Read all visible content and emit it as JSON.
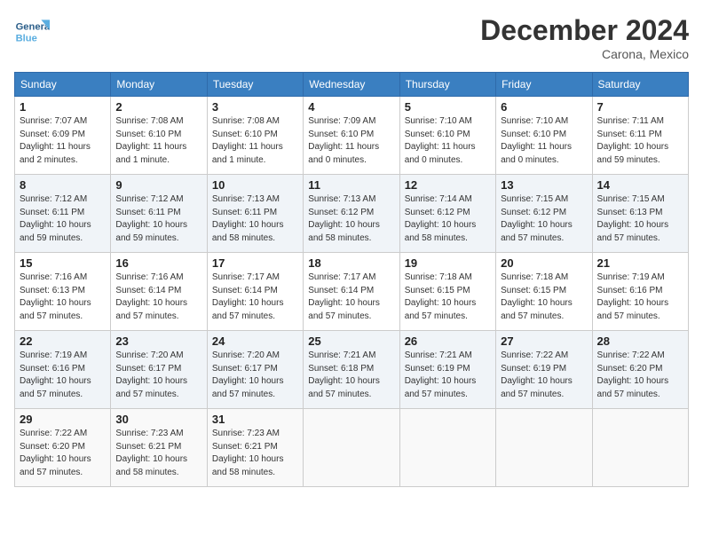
{
  "header": {
    "logo_text_general": "General",
    "logo_text_blue": "Blue",
    "month": "December 2024",
    "location": "Carona, Mexico"
  },
  "days_of_week": [
    "Sunday",
    "Monday",
    "Tuesday",
    "Wednesday",
    "Thursday",
    "Friday",
    "Saturday"
  ],
  "weeks": [
    [
      {
        "day": "1",
        "sunrise": "7:07 AM",
        "sunset": "6:09 PM",
        "daylight": "11 hours and 2 minutes."
      },
      {
        "day": "2",
        "sunrise": "7:08 AM",
        "sunset": "6:10 PM",
        "daylight": "11 hours and 1 minute."
      },
      {
        "day": "3",
        "sunrise": "7:08 AM",
        "sunset": "6:10 PM",
        "daylight": "11 hours and 1 minute."
      },
      {
        "day": "4",
        "sunrise": "7:09 AM",
        "sunset": "6:10 PM",
        "daylight": "11 hours and 0 minutes."
      },
      {
        "day": "5",
        "sunrise": "7:10 AM",
        "sunset": "6:10 PM",
        "daylight": "11 hours and 0 minutes."
      },
      {
        "day": "6",
        "sunrise": "7:10 AM",
        "sunset": "6:10 PM",
        "daylight": "11 hours and 0 minutes."
      },
      {
        "day": "7",
        "sunrise": "7:11 AM",
        "sunset": "6:11 PM",
        "daylight": "10 hours and 59 minutes."
      }
    ],
    [
      {
        "day": "8",
        "sunrise": "7:12 AM",
        "sunset": "6:11 PM",
        "daylight": "10 hours and 59 minutes."
      },
      {
        "day": "9",
        "sunrise": "7:12 AM",
        "sunset": "6:11 PM",
        "daylight": "10 hours and 59 minutes."
      },
      {
        "day": "10",
        "sunrise": "7:13 AM",
        "sunset": "6:11 PM",
        "daylight": "10 hours and 58 minutes."
      },
      {
        "day": "11",
        "sunrise": "7:13 AM",
        "sunset": "6:12 PM",
        "daylight": "10 hours and 58 minutes."
      },
      {
        "day": "12",
        "sunrise": "7:14 AM",
        "sunset": "6:12 PM",
        "daylight": "10 hours and 58 minutes."
      },
      {
        "day": "13",
        "sunrise": "7:15 AM",
        "sunset": "6:12 PM",
        "daylight": "10 hours and 57 minutes."
      },
      {
        "day": "14",
        "sunrise": "7:15 AM",
        "sunset": "6:13 PM",
        "daylight": "10 hours and 57 minutes."
      }
    ],
    [
      {
        "day": "15",
        "sunrise": "7:16 AM",
        "sunset": "6:13 PM",
        "daylight": "10 hours and 57 minutes."
      },
      {
        "day": "16",
        "sunrise": "7:16 AM",
        "sunset": "6:14 PM",
        "daylight": "10 hours and 57 minutes."
      },
      {
        "day": "17",
        "sunrise": "7:17 AM",
        "sunset": "6:14 PM",
        "daylight": "10 hours and 57 minutes."
      },
      {
        "day": "18",
        "sunrise": "7:17 AM",
        "sunset": "6:14 PM",
        "daylight": "10 hours and 57 minutes."
      },
      {
        "day": "19",
        "sunrise": "7:18 AM",
        "sunset": "6:15 PM",
        "daylight": "10 hours and 57 minutes."
      },
      {
        "day": "20",
        "sunrise": "7:18 AM",
        "sunset": "6:15 PM",
        "daylight": "10 hours and 57 minutes."
      },
      {
        "day": "21",
        "sunrise": "7:19 AM",
        "sunset": "6:16 PM",
        "daylight": "10 hours and 57 minutes."
      }
    ],
    [
      {
        "day": "22",
        "sunrise": "7:19 AM",
        "sunset": "6:16 PM",
        "daylight": "10 hours and 57 minutes."
      },
      {
        "day": "23",
        "sunrise": "7:20 AM",
        "sunset": "6:17 PM",
        "daylight": "10 hours and 57 minutes."
      },
      {
        "day": "24",
        "sunrise": "7:20 AM",
        "sunset": "6:17 PM",
        "daylight": "10 hours and 57 minutes."
      },
      {
        "day": "25",
        "sunrise": "7:21 AM",
        "sunset": "6:18 PM",
        "daylight": "10 hours and 57 minutes."
      },
      {
        "day": "26",
        "sunrise": "7:21 AM",
        "sunset": "6:19 PM",
        "daylight": "10 hours and 57 minutes."
      },
      {
        "day": "27",
        "sunrise": "7:22 AM",
        "sunset": "6:19 PM",
        "daylight": "10 hours and 57 minutes."
      },
      {
        "day": "28",
        "sunrise": "7:22 AM",
        "sunset": "6:20 PM",
        "daylight": "10 hours and 57 minutes."
      }
    ],
    [
      {
        "day": "29",
        "sunrise": "7:22 AM",
        "sunset": "6:20 PM",
        "daylight": "10 hours and 57 minutes."
      },
      {
        "day": "30",
        "sunrise": "7:23 AM",
        "sunset": "6:21 PM",
        "daylight": "10 hours and 58 minutes."
      },
      {
        "day": "31",
        "sunrise": "7:23 AM",
        "sunset": "6:21 PM",
        "daylight": "10 hours and 58 minutes."
      },
      null,
      null,
      null,
      null
    ]
  ]
}
